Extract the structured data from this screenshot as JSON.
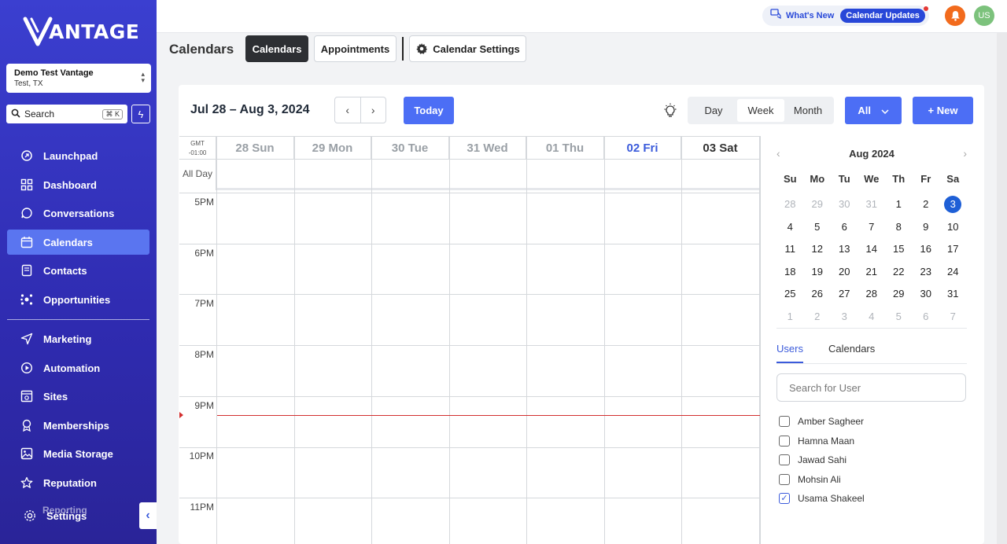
{
  "sidebar": {
    "brand": "ANTAGE",
    "location": {
      "name": "Demo Test Vantage",
      "sub": "Test, TX"
    },
    "search": {
      "label": "Search",
      "shortcut": "⌘ K"
    },
    "items": [
      {
        "label": "Launchpad",
        "icon": "rocket-icon"
      },
      {
        "label": "Dashboard",
        "icon": "dashboard-icon"
      },
      {
        "label": "Conversations",
        "icon": "chat-icon"
      },
      {
        "label": "Calendars",
        "icon": "calendar-icon",
        "active": true
      },
      {
        "label": "Contacts",
        "icon": "contacts-icon"
      },
      {
        "label": "Opportunities",
        "icon": "opportunities-icon"
      },
      {
        "label": "Marketing",
        "icon": "send-icon"
      },
      {
        "label": "Automation",
        "icon": "automation-icon"
      },
      {
        "label": "Sites",
        "icon": "sites-icon"
      },
      {
        "label": "Memberships",
        "icon": "memberships-icon"
      },
      {
        "label": "Media Storage",
        "icon": "image-icon"
      },
      {
        "label": "Reputation",
        "icon": "star-icon"
      },
      {
        "label": "Settings",
        "icon": "gear-icon"
      }
    ],
    "ghost_label": "Reporting"
  },
  "topbar": {
    "whats_new": "What's New",
    "calendar_updates": "Calendar Updates",
    "avatar_initials": "US"
  },
  "subheader": {
    "title": "Calendars",
    "tabs": [
      "Calendars",
      "Appointments"
    ],
    "settings_label": "Calendar Settings"
  },
  "toolbar": {
    "range": "Jul 28 – Aug 3, 2024",
    "today": "Today",
    "views": [
      "Day",
      "Week",
      "Month"
    ],
    "active_view": "Week",
    "filter": "All",
    "new_label": "+ New"
  },
  "grid": {
    "timezone_line1": "GMT",
    "timezone_line2": "-01:00",
    "days": [
      "28 Sun",
      "29 Mon",
      "30 Tue",
      "31 Wed",
      "01 Thu",
      "02 Fri",
      "03 Sat"
    ],
    "today_index": 5,
    "all_day_label": "All Day",
    "hours": [
      "5PM",
      "6PM",
      "7PM",
      "8PM",
      "9PM",
      "10PM",
      "11PM"
    ]
  },
  "mini_calendar": {
    "month": "Aug 2024",
    "weekdays": [
      "Su",
      "Mo",
      "Tu",
      "We",
      "Th",
      "Fr",
      "Sa"
    ],
    "weeks": [
      [
        "28",
        "29",
        "30",
        "31",
        "1",
        "2",
        "3"
      ],
      [
        "4",
        "5",
        "6",
        "7",
        "8",
        "9",
        "10"
      ],
      [
        "11",
        "12",
        "13",
        "14",
        "15",
        "16",
        "17"
      ],
      [
        "18",
        "19",
        "20",
        "21",
        "22",
        "23",
        "24"
      ],
      [
        "25",
        "26",
        "27",
        "28",
        "29",
        "30",
        "31"
      ],
      [
        "1",
        "2",
        "3",
        "4",
        "5",
        "6",
        "7"
      ]
    ],
    "selected": "3"
  },
  "right_panel": {
    "tabs": [
      "Users",
      "Calendars"
    ],
    "search_placeholder": "Search for User",
    "users": [
      {
        "name": "Amber Sagheer",
        "checked": false
      },
      {
        "name": "Hamna Maan",
        "checked": false
      },
      {
        "name": "Jawad Sahi",
        "checked": false
      },
      {
        "name": "Mohsin Ali",
        "checked": false
      },
      {
        "name": "Usama Shakeel",
        "checked": true
      }
    ]
  },
  "colors": {
    "sidebar": "#3b3fd0",
    "accent": "#4c6ef5",
    "now_line": "#d32f2f"
  }
}
